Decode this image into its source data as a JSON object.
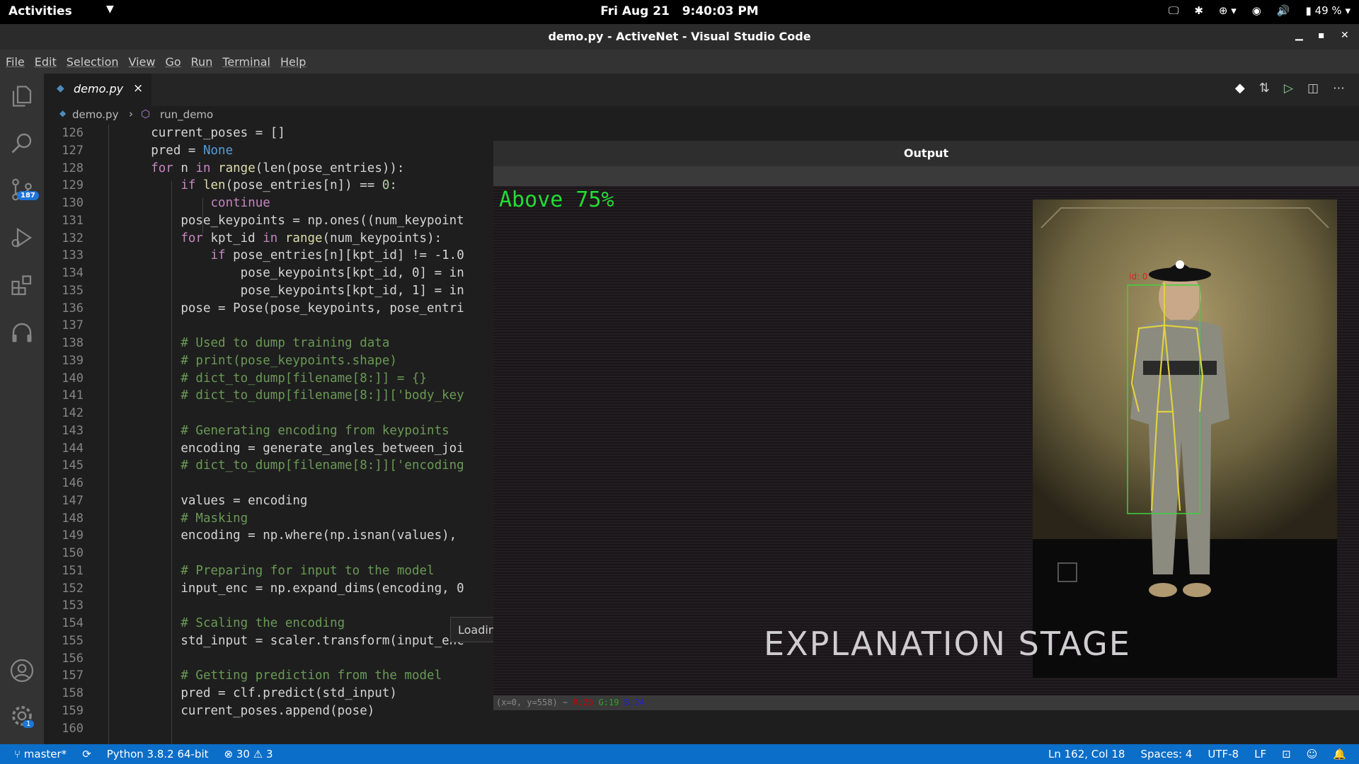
{
  "topbar": {
    "activities": "Activities",
    "date": "Fri Aug 21",
    "time": "9:40:03 PM",
    "battery": "49 %"
  },
  "window": {
    "title": "demo.py - ActiveNet - Visual Studio Code"
  },
  "menu": [
    "File",
    "Edit",
    "Selection",
    "View",
    "Go",
    "Run",
    "Terminal",
    "Help"
  ],
  "activity": {
    "scm_badge": "187",
    "settings_badge": "1"
  },
  "tab": {
    "name": "demo.py",
    "close": "×"
  },
  "breadcrumb": {
    "file": "demo.py",
    "symbol": "run_demo"
  },
  "line_numbers": [
    "126",
    "127",
    "128",
    "129",
    "130",
    "131",
    "132",
    "133",
    "134",
    "135",
    "136",
    "137",
    "138",
    "139",
    "140",
    "141",
    "142",
    "143",
    "144",
    "145",
    "146",
    "147",
    "148",
    "149",
    "150",
    "151",
    "152",
    "153",
    "154",
    "155",
    "156",
    "157",
    "158",
    "159",
    "160"
  ],
  "code": {
    "l126": "current_poses = []",
    "l127a": "pred = ",
    "l127b": "None",
    "l128": "(len(pose_entries)):",
    "l129": "(pose_entries[n]) == ",
    "l130": "continue",
    "l131": "pose_keypoints = np.ones((num_keypoint",
    "l132": "(num_keypoints):",
    "l133": "pose_entries[n][kpt_id] != -1.0",
    "l134": "pose_keypoints[kpt_id, 0] = in",
    "l135": "pose_keypoints[kpt_id, 1] = in",
    "l136": "pose = Pose(pose_keypoints, pose_entri",
    "l138": "# Used to dump training data",
    "l139": "# print(pose_keypoints.shape)",
    "l140": "# dict_to_dump[filename[8:]] = {}",
    "l141": "# dict_to_dump[filename[8:]]['body_key",
    "l143": "# Generating encoding from keypoints",
    "l144": "encoding = generate_angles_between_joi",
    "l145": "# dict_to_dump[filename[8:]]['encoding",
    "l147": "values = encoding",
    "l148": "# Masking",
    "l149": "encoding = np.where(np.isnan(values), ",
    "l151": "# Preparing for input to the model",
    "l152": "input_enc = np.expand_dims(encoding, 0",
    "l154": "# Scaling the encoding",
    "l155": "std_input = scaler.transform(input_enc",
    "l157": "# Getting prediction from the model",
    "l158": "pred = clf.predict(std_input)",
    "l159": "current_poses.append(pose)"
  },
  "tooltip": "Loading...",
  "output": {
    "title": "Output",
    "label": "Above 75%",
    "caption": "EXPLANATION STAGE",
    "coord_prefix": "(x=0, y=558) ~",
    "r": "R:25",
    "g": "G:19",
    "b": "B:24"
  },
  "status": {
    "branch": "master*",
    "python": "Python 3.8.2 64-bit",
    "errors": "30",
    "warnings": "3",
    "position": "Ln 162, Col 18",
    "spaces": "Spaces: 4",
    "encoding": "UTF-8",
    "eol": "LF"
  }
}
